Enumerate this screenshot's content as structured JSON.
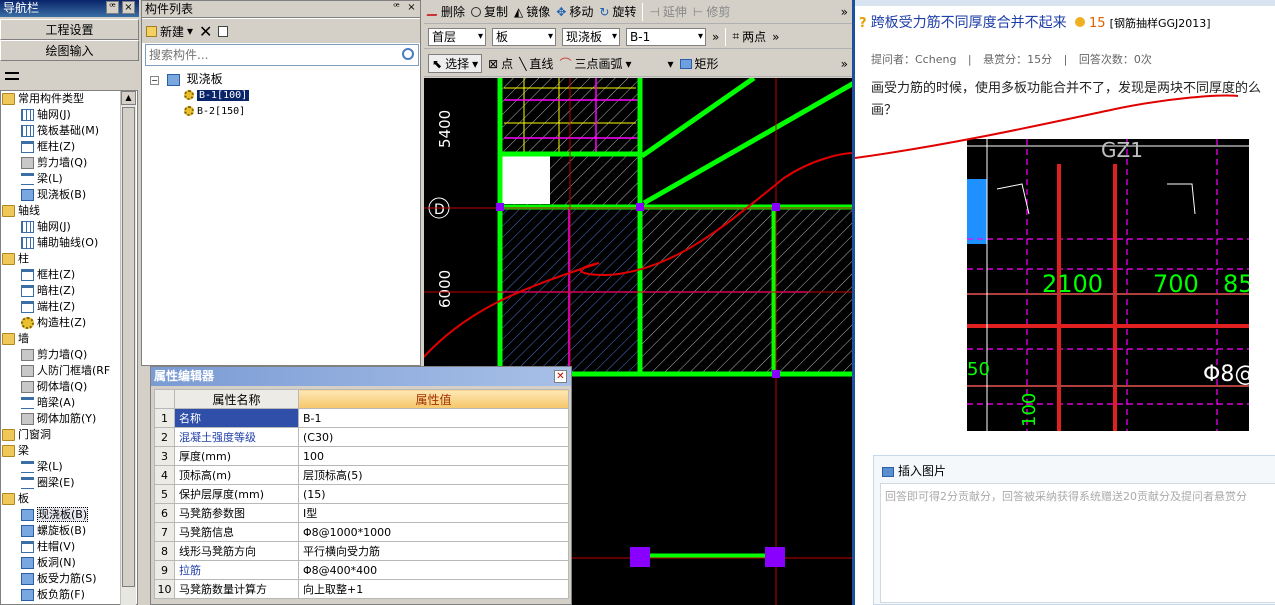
{
  "nav": {
    "title": "导航栏",
    "pin": "ꟹ",
    "close": "×",
    "btn_project": "工程设置",
    "btn_draw": "绘图输入",
    "tree": [
      {
        "label": "常用构件类型",
        "level": 0,
        "icon": "folder-icon"
      },
      {
        "label": "轴网(J)",
        "level": 1,
        "icon": "grid-icon"
      },
      {
        "label": "筏板基础(M)",
        "level": 1,
        "icon": "raft-icon"
      },
      {
        "label": "框柱(Z)",
        "level": 1,
        "icon": "column-icon"
      },
      {
        "label": "剪力墙(Q)",
        "level": 1,
        "icon": "wall-icon"
      },
      {
        "label": "梁(L)",
        "level": 1,
        "icon": "beam-icon"
      },
      {
        "label": "现浇板(B)",
        "level": 1,
        "icon": "slab-icon"
      },
      {
        "label": "轴线",
        "level": 0,
        "icon": "folder-icon"
      },
      {
        "label": "轴网(J)",
        "level": 1,
        "icon": "grid-icon"
      },
      {
        "label": "辅助轴线(O)",
        "level": 1,
        "icon": "aux-axis-icon"
      },
      {
        "label": "柱",
        "level": 0,
        "icon": "folder-icon"
      },
      {
        "label": "框柱(Z)",
        "level": 1,
        "icon": "column-icon"
      },
      {
        "label": "暗柱(Z)",
        "level": 1,
        "icon": "column-icon"
      },
      {
        "label": "端柱(Z)",
        "level": 1,
        "icon": "column-icon"
      },
      {
        "label": "构造柱(Z)",
        "level": 1,
        "icon": "gear-icon"
      },
      {
        "label": "墙",
        "level": 0,
        "icon": "folder-icon"
      },
      {
        "label": "剪力墙(Q)",
        "level": 1,
        "icon": "wall-icon"
      },
      {
        "label": "人防门框墙(RF",
        "level": 1,
        "icon": "door-wall-icon"
      },
      {
        "label": "砌体墙(Q)",
        "level": 1,
        "icon": "wall-icon"
      },
      {
        "label": "暗梁(A)",
        "level": 1,
        "icon": "beam-icon"
      },
      {
        "label": "砌体加筋(Y)",
        "level": 1,
        "icon": "wall-icon"
      },
      {
        "label": "门窗洞",
        "level": 0,
        "icon": "folder-icon"
      },
      {
        "label": "梁",
        "level": 0,
        "icon": "folder-icon"
      },
      {
        "label": "梁(L)",
        "level": 1,
        "icon": "beam-icon"
      },
      {
        "label": "圈梁(E)",
        "level": 1,
        "icon": "beam-icon"
      },
      {
        "label": "板",
        "level": 0,
        "icon": "folder-icon"
      },
      {
        "label": "现浇板(B)",
        "level": 1,
        "icon": "slab-icon",
        "selected": true
      },
      {
        "label": "螺旋板(B)",
        "level": 1,
        "icon": "slab-icon"
      },
      {
        "label": "柱帽(V)",
        "level": 1,
        "icon": "column-icon"
      },
      {
        "label": "板洞(N)",
        "level": 1,
        "icon": "slab-icon"
      },
      {
        "label": "板受力筋(S)",
        "level": 1,
        "icon": "slab-icon"
      },
      {
        "label": "板负筋(F)",
        "level": 1,
        "icon": "slab-icon"
      }
    ]
  },
  "comp": {
    "title": "构件列表",
    "new_label": "新建",
    "search_placeholder": "搜索构件...",
    "root": "现浇板",
    "items": [
      {
        "label": "B-1[100]",
        "selected": true
      },
      {
        "label": "B-2[150]",
        "selected": false
      }
    ]
  },
  "toolbar1": {
    "delete": "删除",
    "copy": "复制",
    "mirror": "镜像",
    "move": "移动",
    "rotate": "旋转",
    "extend": "延伸",
    "trim": "修剪"
  },
  "toolbar2": {
    "floor": "首层",
    "type": "板",
    "sub": "现浇板",
    "comp": "B-1",
    "twopoint": "两点"
  },
  "toolbar3": {
    "select": "选择",
    "point": "点",
    "line": "直线",
    "arc": "三点画弧",
    "rect": "矩形"
  },
  "canvas": {
    "dim1": "5400",
    "dim2": "6000",
    "axis": "D"
  },
  "props": {
    "title": "属性编辑器",
    "col_name": "属性名称",
    "col_value": "属性值",
    "rows": [
      {
        "n": "1",
        "name": "名称",
        "value": "B-1",
        "sel": true
      },
      {
        "n": "2",
        "name": "混凝土强度等级",
        "value": "(C30)",
        "link": true
      },
      {
        "n": "3",
        "name": "厚度(mm)",
        "value": "100"
      },
      {
        "n": "4",
        "name": "顶标高(m)",
        "value": "层顶标高(5)"
      },
      {
        "n": "5",
        "name": "保护层厚度(mm)",
        "value": "(15)"
      },
      {
        "n": "6",
        "name": "马凳筋参数图",
        "value": "I型"
      },
      {
        "n": "7",
        "name": "马凳筋信息",
        "value": "Φ8@1000*1000"
      },
      {
        "n": "8",
        "name": "线形马凳筋方向",
        "value": "平行横向受力筋"
      },
      {
        "n": "9",
        "name": "拉筋",
        "value": "Φ8@400*400",
        "link": true
      },
      {
        "n": "10",
        "name": "马凳筋数量计算方",
        "value": "向上取整+1"
      }
    ]
  },
  "web": {
    "q_title": "跨板受力筋不同厚度合并不起来",
    "reward": "15",
    "tag": "[钢筋抽样GGJ2013]",
    "asker": "提问者：Ccheng",
    "bounty": "悬赏分：15分",
    "answers": "回答次数：0次",
    "body": "画受力筋的时候，使用多板功能合并不了，发现是两块不同厚度的么画？",
    "insert_img": "插入图片",
    "answer_hint": "回答即可得2分贡献分，回答被采纳获得系统赠送20贡献分及提问者悬赏分",
    "cad_labels": {
      "a": "GZ1",
      "b": "2100",
      "c": "700",
      "d": "85",
      "e": "Φ8@",
      "f": "100",
      "g": "50"
    }
  },
  "colors": {
    "accent": "#0a246a",
    "cad_green": "#00ff00",
    "cad_magenta": "#ff00ff",
    "annot_red": "#e00000"
  }
}
